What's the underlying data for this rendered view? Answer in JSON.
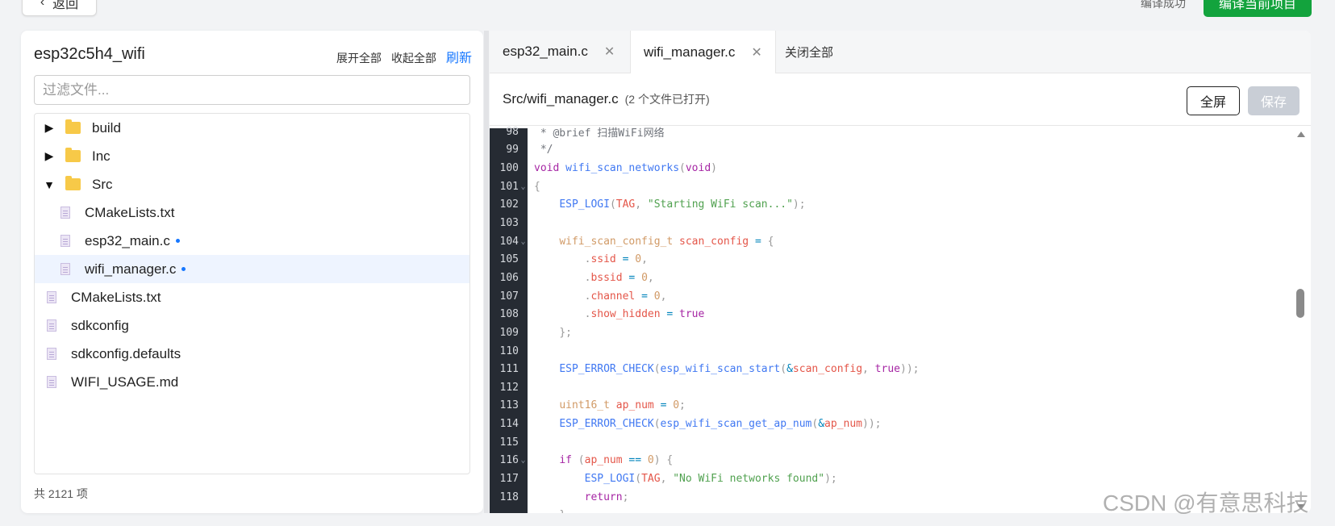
{
  "topbar": {
    "back_label": "返回",
    "status_text": "编译成功",
    "build_label": "编译当前项目"
  },
  "left_panel": {
    "project_name": "esp32c5h4_wifi",
    "expand_all": "展开全部",
    "collapse_all": "收起全部",
    "refresh": "刷新",
    "filter_placeholder": "过滤文件...",
    "items": [
      {
        "label": "build",
        "type": "folder",
        "expanded": false
      },
      {
        "label": "Inc",
        "type": "folder",
        "expanded": false
      },
      {
        "label": "Src",
        "type": "folder",
        "expanded": true
      },
      {
        "label": "CMakeLists.txt",
        "type": "file",
        "modified": false
      },
      {
        "label": "esp32_main.c",
        "type": "file",
        "modified": true
      },
      {
        "label": "wifi_manager.c",
        "type": "file",
        "modified": true,
        "selected": true
      },
      {
        "label": "CMakeLists.txt",
        "type": "file",
        "modified": false
      },
      {
        "label": "sdkconfig",
        "type": "file",
        "modified": false
      },
      {
        "label": "sdkconfig.defaults",
        "type": "file",
        "modified": false
      },
      {
        "label": "WIFI_USAGE.md",
        "type": "file",
        "modified": false
      }
    ],
    "count_text": "共 2121 项"
  },
  "editor": {
    "tabs": [
      {
        "label": "esp32_main.c",
        "active": false
      },
      {
        "label": "wifi_manager.c",
        "active": true
      }
    ],
    "close_all": "关闭全部",
    "file_path": "Src/wifi_manager.c",
    "open_count": "(2 个文件已打开)",
    "fullscreen_label": "全屏",
    "save_label": "保存",
    "lines": [
      {
        "n": "98",
        "text": " * @brief 扫描WiFi网络"
      },
      {
        "n": "99",
        "text": " */"
      },
      {
        "n": "100",
        "text": "void wifi_scan_networks(void)"
      },
      {
        "n": "101",
        "text": "{"
      },
      {
        "n": "102",
        "text": "    ESP_LOGI(TAG, \"Starting WiFi scan...\");"
      },
      {
        "n": "103",
        "text": ""
      },
      {
        "n": "104",
        "text": "    wifi_scan_config_t scan_config = {"
      },
      {
        "n": "105",
        "text": "        .ssid = 0,"
      },
      {
        "n": "106",
        "text": "        .bssid = 0,"
      },
      {
        "n": "107",
        "text": "        .channel = 0,"
      },
      {
        "n": "108",
        "text": "        .show_hidden = true"
      },
      {
        "n": "109",
        "text": "    };"
      },
      {
        "n": "110",
        "text": ""
      },
      {
        "n": "111",
        "text": "    ESP_ERROR_CHECK(esp_wifi_scan_start(&scan_config, true));"
      },
      {
        "n": "112",
        "text": ""
      },
      {
        "n": "113",
        "text": "    uint16_t ap_num = 0;"
      },
      {
        "n": "114",
        "text": "    ESP_ERROR_CHECK(esp_wifi_scan_get_ap_num(&ap_num));"
      },
      {
        "n": "115",
        "text": ""
      },
      {
        "n": "116",
        "text": "    if (ap_num == 0) {"
      },
      {
        "n": "117",
        "text": "        ESP_LOGI(TAG, \"No WiFi networks found\");"
      },
      {
        "n": "118",
        "text": "        return;"
      },
      {
        "n": "",
        "text": "    }"
      }
    ],
    "fold_lines": [
      "101",
      "104",
      "116"
    ]
  },
  "watermark": "CSDN @有意思科技",
  "colors": {
    "primary": "#1677ff",
    "build_green": "#13a33d",
    "gutter_bg": "#262b33",
    "selected_row": "#eef4ff"
  }
}
